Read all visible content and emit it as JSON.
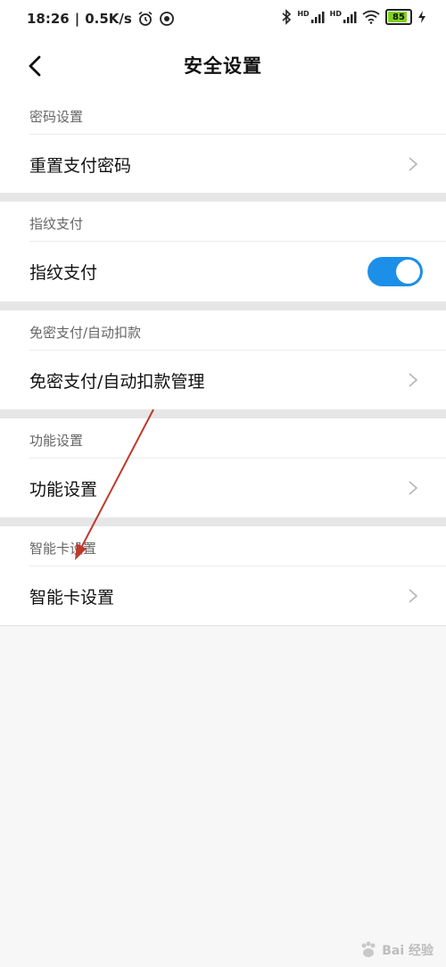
{
  "status_bar": {
    "time": "18:26",
    "speed": "0.5K/s",
    "network_1": "HD",
    "network_2": "HD",
    "battery": "85"
  },
  "header": {
    "title": "安全设置"
  },
  "sections": [
    {
      "header": "密码设置",
      "item": "重置支付密码"
    },
    {
      "header": "指纹支付",
      "item": "指纹支付",
      "toggle_on": true
    },
    {
      "header": "免密支付/自动扣款",
      "item": "免密支付/自动扣款管理"
    },
    {
      "header": "功能设置",
      "item": "功能设置"
    },
    {
      "header": "智能卡设置",
      "item": "智能卡设置"
    }
  ],
  "colors": {
    "toggle_on": "#1c8fe8",
    "annotation_arrow": "#c0392b"
  },
  "icons": {
    "back": "chevron-left-icon",
    "row": "chevron-right-icon"
  },
  "watermark": "Bai 经验"
}
